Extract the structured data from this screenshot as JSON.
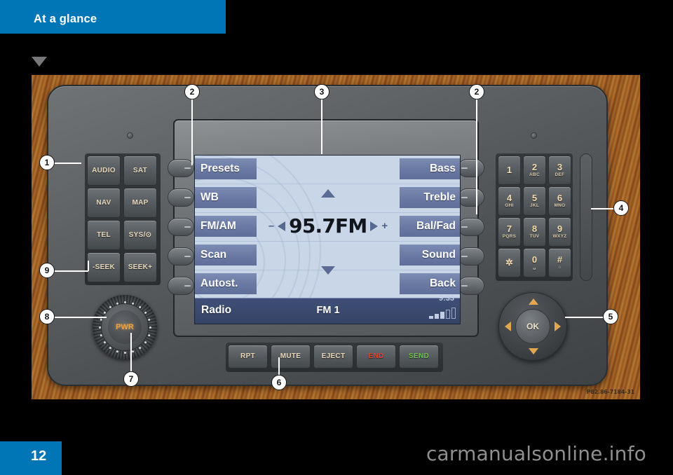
{
  "header": {
    "title": "At a glance"
  },
  "footer": {
    "page_number": "12",
    "watermark": "carmanualsonline.info"
  },
  "photo": {
    "code": "P82.86-7184-31"
  },
  "screen": {
    "left_softkeys": [
      "Presets",
      "WB",
      "FM/AM",
      "Scan",
      "Autost."
    ],
    "right_softkeys": [
      "Bass",
      "Treble",
      "Bal/Fad",
      "Sound",
      "Back"
    ],
    "frequency": "95.7FM",
    "minus_symbol": "–",
    "plus_symbol": "+",
    "status": {
      "source": "Radio",
      "band": "FM 1",
      "clock": "9:33"
    }
  },
  "left_keypad": [
    {
      "label": "AUDIO"
    },
    {
      "label": "SAT"
    },
    {
      "label": "NAV"
    },
    {
      "label": "MAP"
    },
    {
      "label": "TEL"
    },
    {
      "label": "SYS/⊙"
    },
    {
      "label": "-SEEK"
    },
    {
      "label": "SEEK+"
    }
  ],
  "number_keypad": [
    {
      "num": "1",
      "sub": ""
    },
    {
      "num": "2",
      "sub": "ABC"
    },
    {
      "num": "3",
      "sub": "DEF"
    },
    {
      "num": "4",
      "sub": "GHI"
    },
    {
      "num": "5",
      "sub": "JKL"
    },
    {
      "num": "6",
      "sub": "MNO"
    },
    {
      "num": "7",
      "sub": "PQRS"
    },
    {
      "num": "8",
      "sub": "TUV"
    },
    {
      "num": "9",
      "sub": "WXYZ"
    },
    {
      "num": "✲",
      "sub": ""
    },
    {
      "num": "0",
      "sub": "␣"
    },
    {
      "num": "#",
      "sub": "⌂"
    }
  ],
  "bottom_keys": [
    {
      "label": "RPT",
      "style": "normal"
    },
    {
      "label": "MUTE",
      "style": "normal"
    },
    {
      "label": "EJECT",
      "style": "normal"
    },
    {
      "label": "END",
      "style": "end"
    },
    {
      "label": "SEND",
      "style": "send"
    }
  ],
  "power_knob": {
    "label": "PWR"
  },
  "ok_pad": {
    "label": "OK"
  },
  "callouts": [
    {
      "n": "1"
    },
    {
      "n": "2"
    },
    {
      "n": "3"
    },
    {
      "n": "2"
    },
    {
      "n": "4"
    },
    {
      "n": "5"
    },
    {
      "n": "6"
    },
    {
      "n": "7"
    },
    {
      "n": "8"
    },
    {
      "n": "9"
    }
  ],
  "colors": {
    "brand_blue": "#0076b6",
    "screen_bg": "#c9d6e8",
    "softkey_blue": "#6b7aa4",
    "statusbar_blue": "#3f4f77",
    "end_red": "#e4452c",
    "send_green": "#6fc34a",
    "amber_text": "#e8d7b8"
  }
}
